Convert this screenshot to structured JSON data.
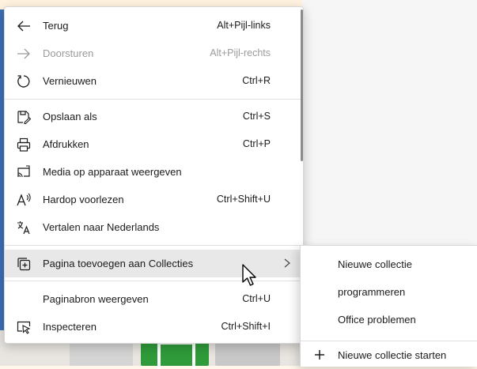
{
  "context_menu": {
    "items": [
      {
        "label": "Terug",
        "shortcut": "Alt+Pijl-links",
        "icon": "back-arrow-icon",
        "disabled": false
      },
      {
        "label": "Doorsturen",
        "shortcut": "Alt+Pijl-rechts",
        "icon": "forward-arrow-icon",
        "disabled": true
      },
      {
        "label": "Vernieuwen",
        "shortcut": "Ctrl+R",
        "icon": "refresh-icon",
        "disabled": false
      },
      {
        "label": "Opslaan als",
        "shortcut": "Ctrl+S",
        "icon": "save-as-icon",
        "disabled": false
      },
      {
        "label": "Afdrukken",
        "shortcut": "Ctrl+P",
        "icon": "print-icon",
        "disabled": false
      },
      {
        "label": "Media op apparaat weergeven",
        "shortcut": "",
        "icon": "cast-media-icon",
        "disabled": false
      },
      {
        "label": "Hardop voorlezen",
        "shortcut": "Ctrl+Shift+U",
        "icon": "read-aloud-icon",
        "disabled": false
      },
      {
        "label": "Vertalen naar Nederlands",
        "shortcut": "",
        "icon": "translate-icon",
        "disabled": false
      },
      {
        "label": "Pagina toevoegen aan Collecties",
        "shortcut": "",
        "icon": "collections-add-icon",
        "disabled": false,
        "has_submenu": true,
        "hovered": true
      },
      {
        "label": "Paginabron weergeven",
        "shortcut": "Ctrl+U",
        "icon": "",
        "disabled": false
      },
      {
        "label": "Inspecteren",
        "shortcut": "Ctrl+Shift+I",
        "icon": "inspect-icon",
        "disabled": false
      }
    ]
  },
  "submenu": {
    "items": [
      {
        "label": "Nieuwe collectie"
      },
      {
        "label": "programmeren"
      },
      {
        "label": "Office problemen"
      }
    ],
    "start_new": {
      "label": "Nieuwe collectie starten",
      "icon": "plus-icon"
    }
  }
}
